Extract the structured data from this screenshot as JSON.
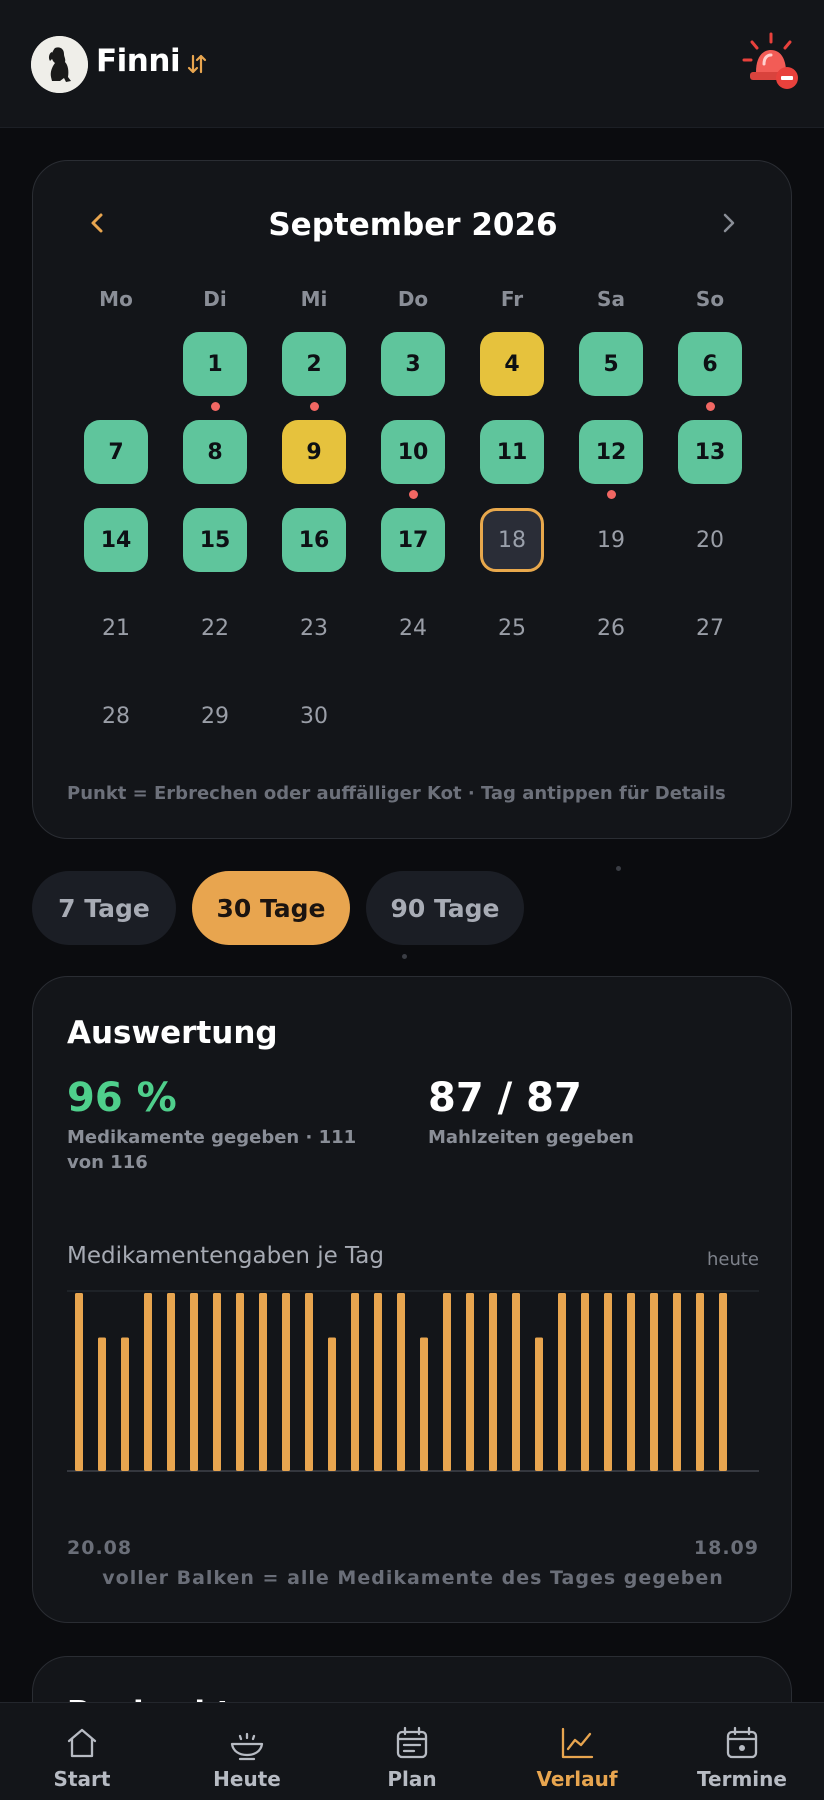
{
  "header": {
    "pet_name": "Finni",
    "avatar_icon": "dog-avatar",
    "switch_icon": "swap-arrows-icon",
    "alarm_icon": "emergency-siren-icon"
  },
  "calendar": {
    "month_title": "September 2026",
    "prev_label": "‹",
    "next_label": "›",
    "weekdays": [
      "Mo",
      "Di",
      "Mi",
      "Do",
      "Fr",
      "Sa",
      "So"
    ],
    "days": [
      {
        "num": "1",
        "status": "green",
        "marked": true
      },
      {
        "num": "2",
        "status": "green",
        "marked": true
      },
      {
        "num": "3",
        "status": "green",
        "marked": false
      },
      {
        "num": "4",
        "status": "yellow",
        "marked": false
      },
      {
        "num": "5",
        "status": "green",
        "marked": false
      },
      {
        "num": "6",
        "status": "green",
        "marked": true
      },
      {
        "num": "7",
        "status": "green",
        "marked": false
      },
      {
        "num": "8",
        "status": "green",
        "marked": false
      },
      {
        "num": "9",
        "status": "yellow",
        "marked": false
      },
      {
        "num": "10",
        "status": "green",
        "marked": true
      },
      {
        "num": "11",
        "status": "green",
        "marked": false
      },
      {
        "num": "12",
        "status": "green",
        "marked": true
      },
      {
        "num": "13",
        "status": "green",
        "marked": false
      },
      {
        "num": "14",
        "status": "green",
        "marked": false
      },
      {
        "num": "15",
        "status": "green",
        "marked": false
      },
      {
        "num": "16",
        "status": "green",
        "marked": false
      },
      {
        "num": "17",
        "status": "green",
        "marked": false
      },
      {
        "num": "18",
        "status": "today",
        "marked": false
      },
      {
        "num": "19",
        "status": "future",
        "marked": false
      },
      {
        "num": "20",
        "status": "future",
        "marked": false
      },
      {
        "num": "21",
        "status": "future",
        "marked": false
      },
      {
        "num": "22",
        "status": "future",
        "marked": false
      },
      {
        "num": "23",
        "status": "future",
        "marked": false
      },
      {
        "num": "24",
        "status": "future",
        "marked": false
      },
      {
        "num": "25",
        "status": "future",
        "marked": false
      },
      {
        "num": "26",
        "status": "future",
        "marked": false
      },
      {
        "num": "27",
        "status": "future",
        "marked": false
      },
      {
        "num": "28",
        "status": "future",
        "marked": false
      },
      {
        "num": "29",
        "status": "future",
        "marked": false
      },
      {
        "num": "30",
        "status": "future",
        "marked": false
      }
    ],
    "legend": "Punkt = Erbrechen oder auffälliger Kot · Tag antippen für Details"
  },
  "range": {
    "options": [
      "7 Tage",
      "30 Tage",
      "90 Tage"
    ],
    "selected": "30 Tage"
  },
  "evaluation": {
    "title": "Auswertung",
    "med_percent": "96 %",
    "med_label": "Medikamente gegeben · 111 von 116",
    "meals_value": "87 / 87",
    "meals_label": "Mahlzeiten gegeben",
    "chart_title": "Medikamentengaben je Tag",
    "chart_today": "heute",
    "x_start": "20.08",
    "x_end": "18.09",
    "chart_note": "voller Balken = alle Medikamente des Tages gegeben"
  },
  "chart_data": {
    "type": "bar",
    "x_start": "20.08",
    "x_end": "18.09",
    "values": [
      1,
      0.75,
      0.75,
      1,
      1,
      1,
      1,
      1,
      1,
      1,
      1,
      0.75,
      1,
      1,
      1,
      0.75,
      1,
      1,
      1,
      1,
      0.75,
      1,
      1,
      1,
      1,
      1,
      1,
      1,
      1
    ],
    "ylim": [
      0,
      1
    ],
    "grid": false,
    "color": "#e8a54f"
  },
  "next_card": {
    "title": "Beobachtungen"
  },
  "nav": {
    "items": [
      {
        "label": "Start",
        "icon": "home-icon"
      },
      {
        "label": "Heute",
        "icon": "food-bowl-icon"
      },
      {
        "label": "Plan",
        "icon": "plan-calendar-icon"
      },
      {
        "label": "Verlauf",
        "icon": "chart-icon"
      },
      {
        "label": "Termine",
        "icon": "appointments-calendar-icon"
      }
    ],
    "active": "Verlauf"
  },
  "colors": {
    "accent": "#e8a54f",
    "green": "#5fc59c",
    "yellow": "#e6c23d",
    "dot_red": "#f16763",
    "success_text": "#4fcf8c"
  }
}
